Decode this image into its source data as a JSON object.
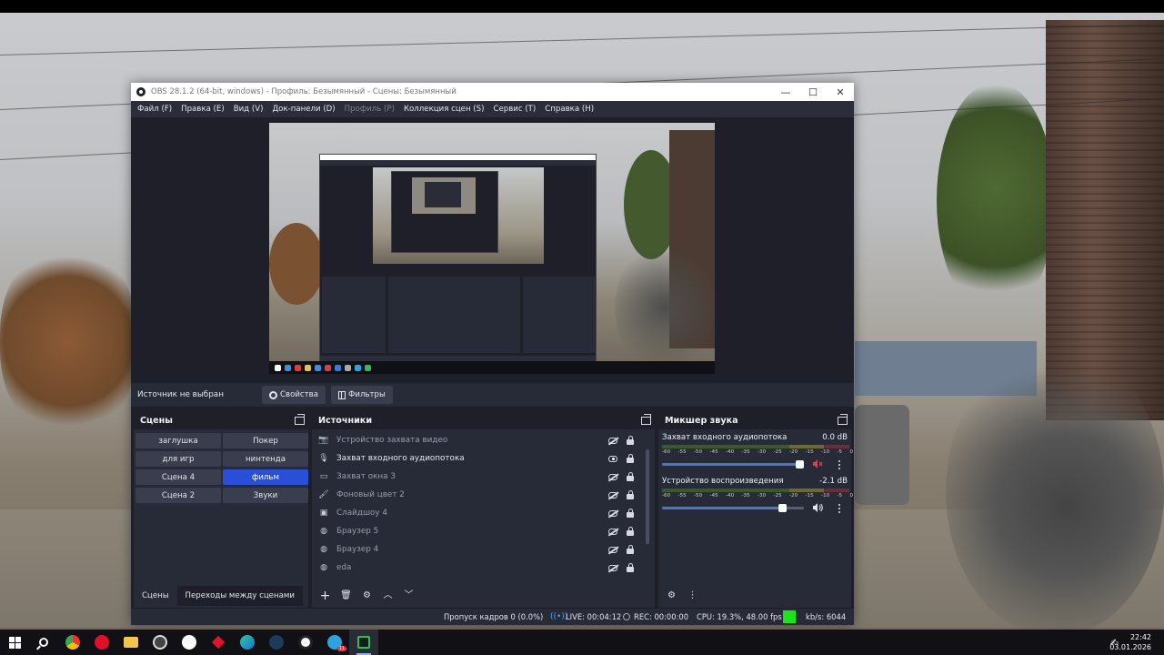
{
  "window": {
    "title": "OBS 28.1.2 (64-bit, windows) - Профиль: Безымянный - Сцены: Безымянный",
    "minimize": "—",
    "maximize": "☐",
    "close": "✕"
  },
  "menu": [
    {
      "label": "Файл (F)",
      "enabled": true
    },
    {
      "label": "Правка (E)",
      "enabled": true
    },
    {
      "label": "Вид (V)",
      "enabled": true
    },
    {
      "label": "Док-панели (D)",
      "enabled": true
    },
    {
      "label": "Профиль (P)",
      "enabled": false
    },
    {
      "label": "Коллекция сцен (S)",
      "enabled": true
    },
    {
      "label": "Сервис (T)",
      "enabled": true
    },
    {
      "label": "Справка (H)",
      "enabled": true
    }
  ],
  "source_bar": {
    "no_source": "Источник не выбран",
    "properties": "Свойства",
    "filters": "Фильтры"
  },
  "scenes": {
    "title": "Сцены",
    "items": [
      {
        "label": "заглушка",
        "active": false
      },
      {
        "label": "Покер",
        "active": false
      },
      {
        "label": "для игр",
        "active": false
      },
      {
        "label": "нинтенда",
        "active": false
      },
      {
        "label": "Сцена 4",
        "active": false
      },
      {
        "label": "фильм",
        "active": true
      },
      {
        "label": "Сцена 2",
        "active": false
      },
      {
        "label": "Звуки",
        "active": false
      }
    ],
    "tab_scenes": "Сцены",
    "tab_transitions": "Переходы между сценами"
  },
  "sources": {
    "title": "Источники",
    "items": [
      {
        "label": "Устройство захвата видео",
        "icon": "camera-icon",
        "visible": false
      },
      {
        "label": "Захват входного аудиопотока",
        "icon": "microphone-icon",
        "visible": true
      },
      {
        "label": "Захват окна 3",
        "icon": "window-icon",
        "visible": false
      },
      {
        "label": "Фоновый цвет 2",
        "icon": "paint-brush-icon",
        "visible": false
      },
      {
        "label": "Слайдшоу 4",
        "icon": "slideshow-icon",
        "visible": false
      },
      {
        "label": "Браузер 5",
        "icon": "globe-icon",
        "visible": false
      },
      {
        "label": "Браузер 4",
        "icon": "globe-icon",
        "visible": false
      },
      {
        "label": "eda",
        "icon": "globe-icon",
        "visible": false
      }
    ]
  },
  "mixer": {
    "title": "Микшер звука",
    "ticks": [
      "-60",
      "-55",
      "-50",
      "-45",
      "-40",
      "-35",
      "-30",
      "-25",
      "-20",
      "-15",
      "-10",
      "-5",
      "0"
    ],
    "channels": [
      {
        "name": "Захват входного аудиопотока",
        "db": "0.0 dB",
        "volume": 1.0,
        "muted": true
      },
      {
        "name": "Устройство воспроизведения",
        "db": "-2.1 dB",
        "volume": 0.87,
        "muted": false
      }
    ]
  },
  "status": {
    "dropped": "Пропуск кадров 0 (0.0%)",
    "live": "LIVE: 00:04:12",
    "rec": "REC: 00:00:00",
    "cpu": "CPU: 19.3%, 48.00 fps",
    "kbs": "kb/s: 6044",
    "health_color": "#1fe21f"
  },
  "taskbar": {
    "time": "22:42",
    "date": "03.01.2026",
    "telegram_badge": "11",
    "apps": [
      "chrome-icon",
      "opera-icon",
      "file-explorer-icon",
      "steam-icon",
      "yandex-browser-icon",
      "game-icon",
      "edge-icon",
      "steam-icon",
      "settings-icon",
      "telegram-icon",
      "obs-icon"
    ]
  }
}
